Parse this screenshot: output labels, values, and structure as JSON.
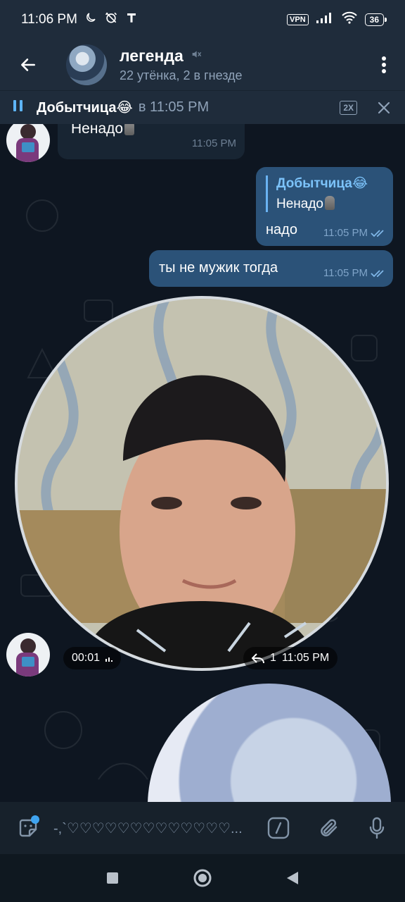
{
  "status_bar": {
    "time": "11:06 PM",
    "vpn": "VPN",
    "battery": "36"
  },
  "header": {
    "title": "легенда",
    "subtitle": "22 утёнка, 2 в гнезде"
  },
  "player": {
    "title": "Добытчица😂",
    "time": "в 11:05 PM",
    "speed": "2X"
  },
  "messages": [
    {
      "type": "incoming",
      "text": "Ненадо",
      "time": "11:05 PM"
    },
    {
      "type": "outgoing",
      "reply_name": "Добытчица😂",
      "reply_text": "Ненадо",
      "text": "надо",
      "time": "11:05 PM"
    },
    {
      "type": "outgoing",
      "text": "ты не мужик тогда",
      "time": "11:05 PM"
    },
    {
      "type": "round-video",
      "duration": "00:01",
      "replies": "1",
      "time": "11:05 PM"
    }
  ],
  "input": {
    "text": "-,`♡♡♡♡♡♡♡♡♡♡♡♡♡..."
  },
  "colors": {
    "header_bg": "#1f2c3b",
    "chat_bg": "#0e1621",
    "incoming_bubble": "#182533",
    "outgoing_bubble": "#2b5278",
    "accent": "#6ab3f3"
  }
}
